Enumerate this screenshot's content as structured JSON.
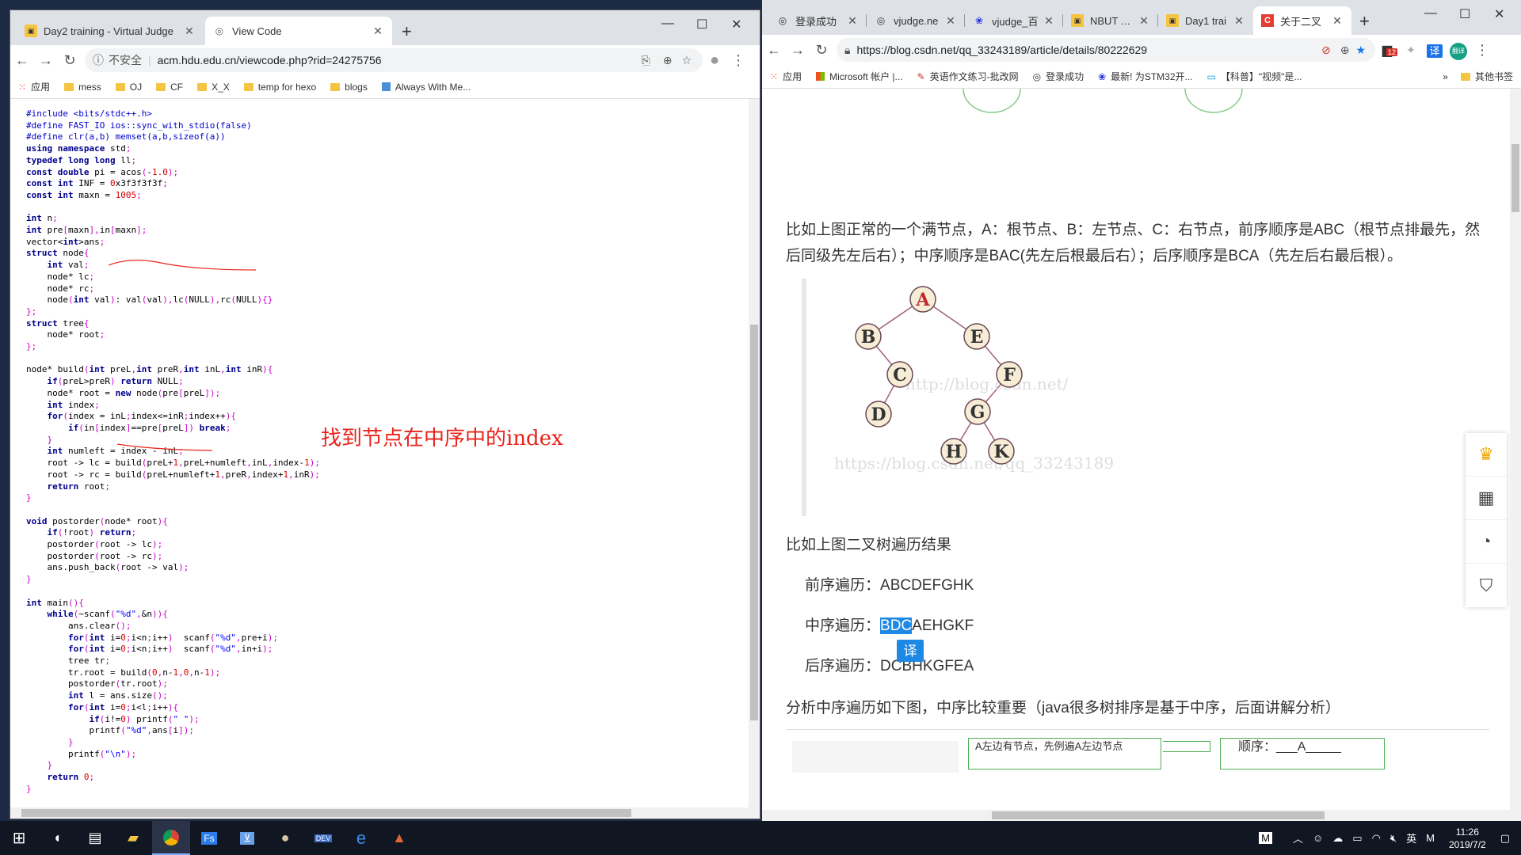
{
  "left_browser": {
    "tabs": [
      {
        "label": "Day2 training - Virtual Judge",
        "icon": "vjudge-icon",
        "active": false
      },
      {
        "label": "View Code",
        "icon": "globe-icon",
        "active": true
      }
    ],
    "security_label": "不安全",
    "url": "acm.hdu.edu.cn/viewcode.php?rid=24275756",
    "bookmarks": [
      {
        "label": "应用",
        "icon": "apps-grid-icon"
      },
      {
        "label": "mess",
        "icon": "folder-icon"
      },
      {
        "label": "OJ",
        "icon": "folder-icon"
      },
      {
        "label": "CF",
        "icon": "folder-icon"
      },
      {
        "label": "X_X",
        "icon": "folder-icon"
      },
      {
        "label": "temp for hexo",
        "icon": "folder-icon"
      },
      {
        "label": "blogs",
        "icon": "folder-icon"
      },
      {
        "label": "Always With Me...",
        "icon": "page-icon"
      }
    ],
    "code_lines": [
      "#include <bits/stdc++.h>",
      "#define FAST_IO ios::sync_with_stdio(false)",
      "#define clr(a,b) memset(a,b,sizeof(a))",
      "using namespace std;",
      "typedef long long ll;",
      "const double pi = acos(-1.0);",
      "const int INF = 0x3f3f3f3f;",
      "const int maxn = 1005;",
      "",
      "int n;",
      "int pre[maxn],in[maxn];",
      "vector<int>ans;",
      "struct node{",
      "    int val;",
      "    node* lc;",
      "    node* rc;",
      "    node(int val): val(val),lc(NULL),rc(NULL){}",
      "};",
      "struct tree{",
      "    node* root;",
      "};",
      "",
      "node* build(int preL,int preR,int inL,int inR){",
      "    if(preL>preR) return NULL;",
      "    node* root = new node(pre[preL]);",
      "    int index;",
      "    for(index = inL;index<=inR;index++){",
      "        if(in[index]==pre[preL]) break;",
      "    }",
      "    int numleft = index - inL;",
      "    root -> lc = build(preL+1,preL+numleft,inL,index-1);",
      "    root -> rc = build(preL+numleft+1,preR,index+1,inR);",
      "    return root;",
      "}",
      "",
      "void postorder(node* root){",
      "    if(!root) return;",
      "    postorder(root -> lc);",
      "    postorder(root -> rc);",
      "    ans.push_back(root -> val);",
      "}",
      "",
      "int main(){",
      "    while(~scanf(\"%d\",&n)){",
      "        ans.clear();",
      "        for(int i=0;i<n;i++)  scanf(\"%d\",pre+i);",
      "        for(int i=0;i<n;i++)  scanf(\"%d\",in+i);",
      "        tree tr;",
      "        tr.root = build(0,n-1,0,n-1);",
      "        postorder(tr.root);",
      "        int l = ans.size();",
      "        for(int i=0;i<l;i++){",
      "            if(i!=0) printf(\" \");",
      "            printf(\"%d\",ans[i]);",
      "        }",
      "        printf(\"\\n\");",
      "    }",
      "    return 0;",
      "}"
    ],
    "annotation": "找到节点在中序中的index"
  },
  "right_browser": {
    "tabs": [
      {
        "label": "登录成功",
        "icon": "globe-icon"
      },
      {
        "label": "vjudge.ne",
        "icon": "globe-icon"
      },
      {
        "label": "vjudge_百",
        "icon": "baidu-icon"
      },
      {
        "label": "NBUT AC",
        "icon": "nbut-icon"
      },
      {
        "label": "Day1 trai",
        "icon": "vjudge-icon"
      },
      {
        "label": "关于二叉",
        "icon": "csdn-icon"
      }
    ],
    "url": "https://blog.csdn.net/qq_33243189/article/details/80222629",
    "extension_badge": "12",
    "avatar_text": "翻译",
    "bookmarks": [
      {
        "label": "应用",
        "icon": "apps-grid-icon"
      },
      {
        "label": "Microsoft 帐户 |...",
        "icon": "microsoft-icon"
      },
      {
        "label": "英语作文练习-批改网",
        "icon": "pen-icon"
      },
      {
        "label": "登录成功",
        "icon": "globe-icon"
      },
      {
        "label": "最新! 为STM32开...",
        "icon": "baidu-icon"
      },
      {
        "label": "【科普】\"视频\"是...",
        "icon": "bilibili-icon"
      },
      {
        "label": "其他书签",
        "icon": "folder-icon"
      }
    ],
    "article": {
      "para1": "比如上图正常的一个满节点，A：根节点、B：左节点、C：右节点，前序顺序是ABC（根节点排最先，然后同级先左后右）；中序顺序是BAC(先左后根最后右）；后序顺序是BCA（先左后右最后根）。",
      "tree_nodes": [
        "A",
        "B",
        "E",
        "C",
        "F",
        "D",
        "G",
        "H",
        "K"
      ],
      "watermark1": "http://blog.csdn.net/",
      "watermark2": "https://blog.csdn.net/qq_33243189",
      "para2": "比如上图二叉树遍历结果",
      "preorder_label": "前序遍历：",
      "preorder_value": "ABCDEFGHK",
      "inorder_label": "中序遍历：",
      "inorder_highlight": "BDC",
      "inorder_rest": "AEHGKF",
      "postorder_label": "后序遍历：",
      "postorder_value": "DCBHKGFEA",
      "translate_button": "译",
      "para3": "分析中序遍历如下图，中序比较重要（java很多树排序是基于中序，后面讲解分析）",
      "diagram_box1": "A左边有节点，先例遍A左边节点",
      "diagram_box2": "顺序：___A_____"
    }
  },
  "taskbar": {
    "tray_ime": "英",
    "tray_m": "M",
    "time": "11:26",
    "date": "2019/7/2"
  }
}
